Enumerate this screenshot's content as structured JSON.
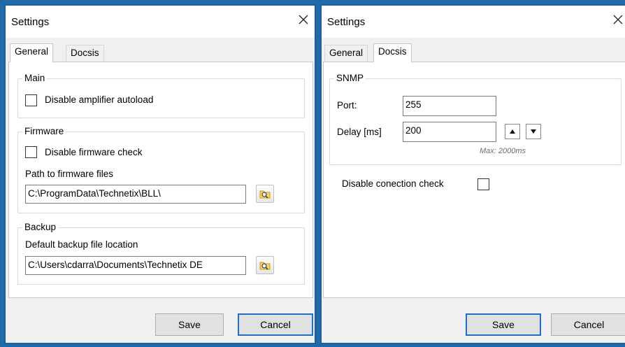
{
  "left_dialog": {
    "title": "Settings",
    "tabs": {
      "general": "General",
      "docsis": "Docsis"
    },
    "main_group": {
      "title": "Main",
      "disable_amplifier_autoload": {
        "label": "Disable amplifier autoload",
        "checked": false
      }
    },
    "firmware_group": {
      "title": "Firmware",
      "disable_firmware_check": {
        "label": "Disable firmware check",
        "checked": false
      },
      "path_label": "Path to firmware files",
      "path_value": "C:\\ProgramData\\Technetix\\BLL\\"
    },
    "backup_group": {
      "title": "Backup",
      "location_label": "Default backup file location",
      "location_value": "C:\\Users\\cdarra\\Documents\\Technetix DE"
    },
    "buttons": {
      "save": "Save",
      "cancel": "Cancel"
    }
  },
  "right_dialog": {
    "title": "Settings",
    "tabs": {
      "general": "General",
      "docsis": "Docsis"
    },
    "snmp_group": {
      "title": "SNMP",
      "port_label": "Port:",
      "port_value": "255",
      "delay_label": "Delay [ms]",
      "delay_value": "200",
      "delay_hint": "Max: 2000ms"
    },
    "disable_connection_check": {
      "label": "Disable conection check",
      "checked": false
    },
    "buttons": {
      "save": "Save",
      "cancel": "Cancel"
    }
  },
  "icons": {
    "close": "close-icon",
    "browse": "folder-search-icon",
    "spin_up": "arrow-up-icon",
    "spin_down": "arrow-down-icon"
  },
  "colors": {
    "window_border": "#1c5f99",
    "default_button_border": "#1f6fc4",
    "dialog_bg": "#f0f0f0"
  }
}
